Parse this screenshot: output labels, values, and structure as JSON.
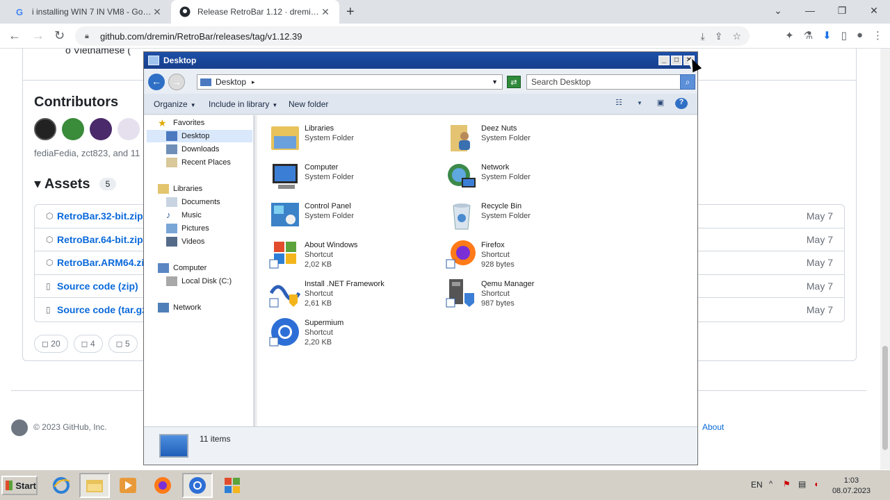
{
  "browser": {
    "tabs": [
      {
        "title": "i installing WIN 7 IN VM8 - Google S",
        "favicon": "G"
      },
      {
        "title": "Release RetroBar 1.12 · dremin/Ret",
        "favicon": "gh"
      }
    ],
    "url": "github.com/dremin/RetroBar/releases/tag/v1.12.39"
  },
  "github": {
    "bullet_text": "o  Vietnamese (",
    "contributors_title": "Contributors",
    "contributors_names": "fediaFedia, zct823, and 11",
    "assets_title": "Assets",
    "assets_count": "5",
    "assets": [
      {
        "name": "RetroBar.32-bit.zip",
        "suffix": "",
        "date": "May 7"
      },
      {
        "name": "RetroBar.64-bit.zip",
        "suffix": "",
        "date": "May 7"
      },
      {
        "name": "RetroBar.ARM64.zip",
        "suffix": "",
        "date": "May 7"
      },
      {
        "name": "Source code",
        "suffix": " (zip)",
        "date": "May 7"
      },
      {
        "name": "Source code",
        "suffix": " (tar.gz)",
        "date": "May 7"
      }
    ],
    "reactions": [
      "20",
      "4",
      "5"
    ],
    "copyright": "© 2023 GitHub, Inc.",
    "about": "About"
  },
  "explorer": {
    "title": "Desktop",
    "address": "Desktop",
    "search_placeholder": "Search Desktop",
    "commands": {
      "organize": "Organize",
      "include": "Include in library",
      "new_folder": "New folder"
    },
    "nav": {
      "favorites": "Favorites",
      "desktop": "Desktop",
      "downloads": "Downloads",
      "recent": "Recent Places",
      "libraries": "Libraries",
      "documents": "Documents",
      "music": "Music",
      "pictures": "Pictures",
      "videos": "Videos",
      "computer": "Computer",
      "localdisk": "Local Disk (C:)",
      "network": "Network"
    },
    "items": [
      {
        "name": "Libraries",
        "type": "System Folder",
        "size": ""
      },
      {
        "name": "Deez Nuts",
        "type": "System Folder",
        "size": ""
      },
      {
        "name": "Computer",
        "type": "System Folder",
        "size": ""
      },
      {
        "name": "Network",
        "type": "System Folder",
        "size": ""
      },
      {
        "name": "Control Panel",
        "type": "System Folder",
        "size": ""
      },
      {
        "name": "Recycle Bin",
        "type": "System Folder",
        "size": ""
      },
      {
        "name": "About Windows",
        "type": "Shortcut",
        "size": "2,02 KB"
      },
      {
        "name": "Firefox",
        "type": "Shortcut",
        "size": "928 bytes"
      },
      {
        "name": "Install .NET Framework",
        "type": "Shortcut",
        "size": "2,61 KB"
      },
      {
        "name": "Qemu Manager",
        "type": "Shortcut",
        "size": "987 bytes"
      },
      {
        "name": "Supermium",
        "type": "Shortcut",
        "size": "2,20 KB"
      }
    ],
    "status_count": "11 items"
  },
  "taskbar": {
    "start": "Start",
    "lang": "EN",
    "time": "1:03",
    "date": "08.07.2023"
  }
}
